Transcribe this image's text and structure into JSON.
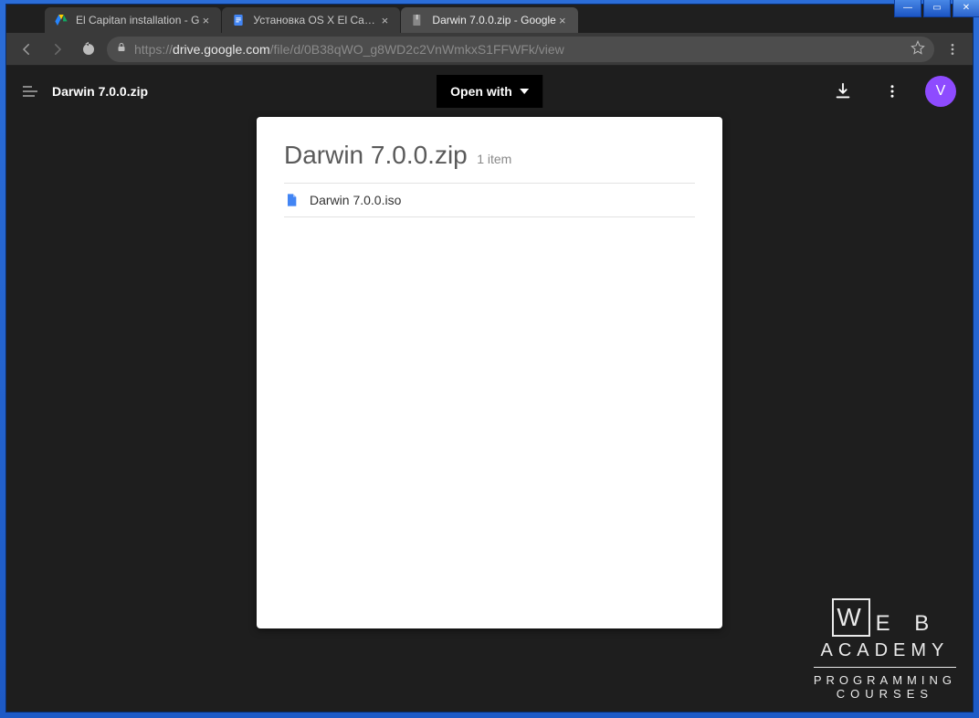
{
  "window_controls": {
    "minimize": "—",
    "maximize": "▭",
    "close": "✕"
  },
  "tabs": [
    {
      "title": "El Capitan installation - G"
    },
    {
      "title": "Установка OS X El Capit."
    },
    {
      "title": "Darwin 7.0.0.zip - Google"
    }
  ],
  "address": {
    "scheme": "https://",
    "host": "drive.google.com",
    "path": "/file/d/0B38qWO_g8WD2c2VnWmkxS1FFWFk/view"
  },
  "viewer": {
    "filename": "Darwin 7.0.0.zip",
    "open_with": "Open with",
    "avatar_initial": "V"
  },
  "preview": {
    "title": "Darwin 7.0.0.zip",
    "count": "1 item",
    "items": [
      {
        "name": "Darwin 7.0.0.iso"
      }
    ]
  },
  "watermark": {
    "w": "W",
    "eb": "E B",
    "academy": "ACADEMY",
    "programming": "PROGRAMMING",
    "courses": "COURSES"
  }
}
